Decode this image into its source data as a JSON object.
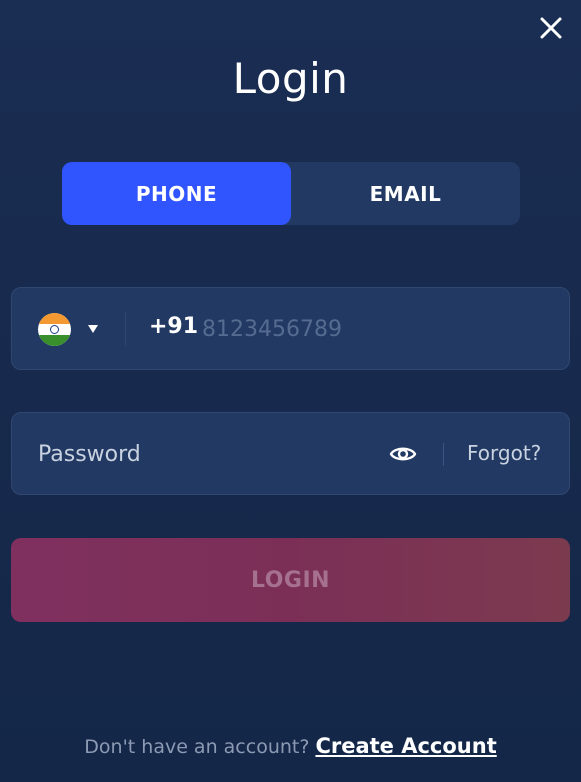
{
  "modal": {
    "title": "Login",
    "close_icon": "close-icon"
  },
  "tabs": [
    {
      "label": "PHONE",
      "active": true
    },
    {
      "label": "EMAIL",
      "active": false
    }
  ],
  "phone": {
    "country_flag": "india-flag-icon",
    "dial_code": "+91",
    "placeholder": "8123456789",
    "value": ""
  },
  "password": {
    "placeholder": "Password",
    "value": "",
    "toggle_icon": "eye-icon",
    "forgot_label": "Forgot?"
  },
  "login_button": {
    "label": "LOGIN"
  },
  "footer": {
    "prompt": "Don't have an account?",
    "create_account_label": "Create Account"
  },
  "colors": {
    "background": "#172a4c",
    "tab_active": "#3055ff",
    "field_bg": "#223a63",
    "login_button": "#7b2f56"
  }
}
